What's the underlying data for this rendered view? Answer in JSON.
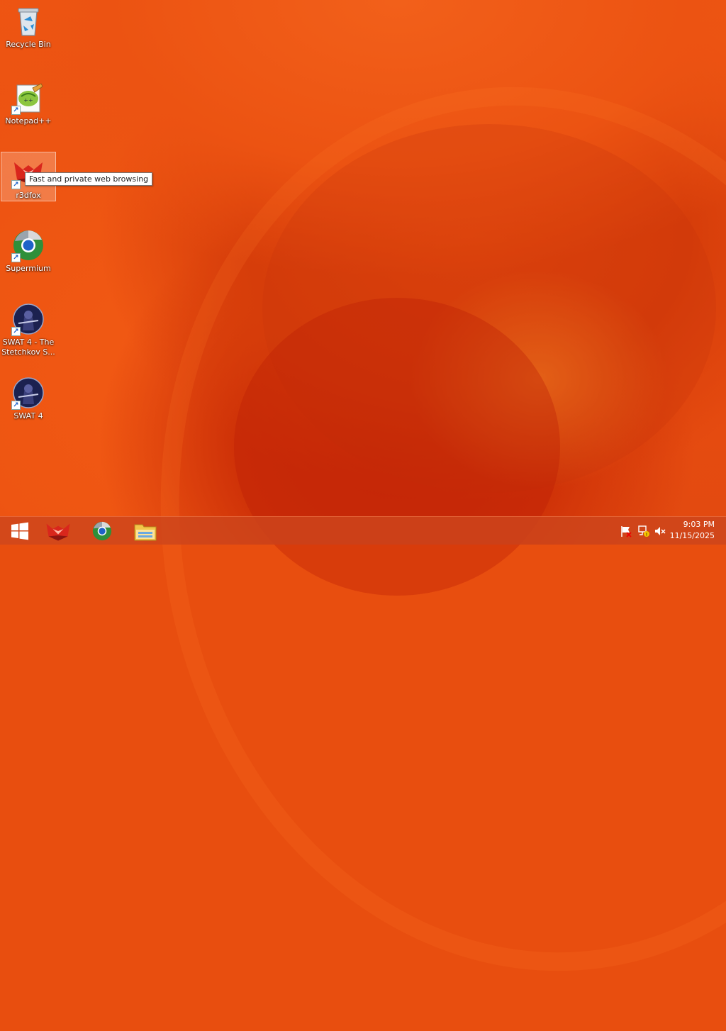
{
  "desktop": {
    "icons": [
      {
        "label": "Recycle Bin",
        "icon": "recycle-bin-icon"
      },
      {
        "label": "Notepad++",
        "icon": "notepadpp-icon"
      },
      {
        "label": "r3dfox",
        "icon": "r3dfox-icon"
      },
      {
        "label": "Supermium",
        "icon": "supermium-icon"
      },
      {
        "label": "SWAT 4 - The Stetchkov S...",
        "icon": "swat4-icon"
      },
      {
        "label": "SWAT 4",
        "icon": "swat4-icon"
      }
    ],
    "tooltip": "Fast and private web browsing"
  },
  "taskbar": {
    "start": "windows-logo-icon",
    "pinned": [
      "r3dfox-icon",
      "supermium-icon",
      "file-explorer-icon"
    ],
    "tray": [
      "action-center-flag-icon",
      "network-icon",
      "volume-muted-icon"
    ],
    "time": "9:03 PM",
    "date": "11/15/2025"
  },
  "colors": {
    "wallpaper": "#e84e0f",
    "taskbar": "#cd461c"
  }
}
